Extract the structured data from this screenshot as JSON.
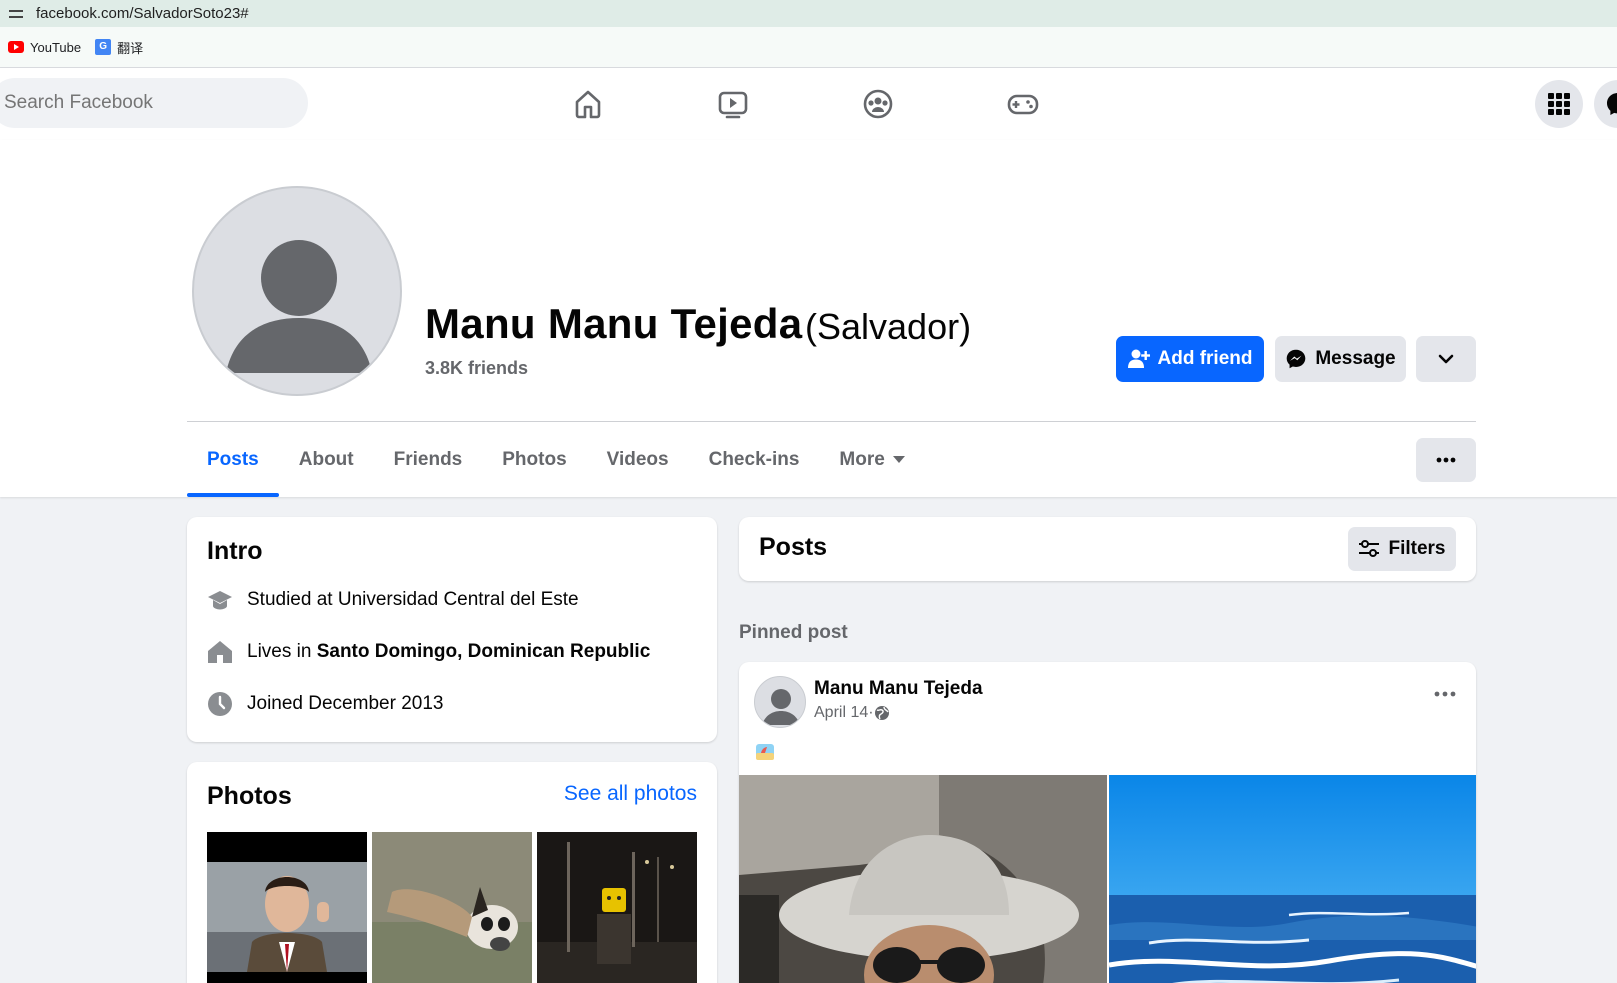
{
  "browser": {
    "url": "facebook.com/SalvadorSoto23#",
    "bookmarks": [
      {
        "label": "YouTube",
        "icon": "youtube-icon"
      },
      {
        "label": "翻译",
        "icon": "translate-icon"
      }
    ]
  },
  "nav": {
    "search_placeholder": "Search Facebook",
    "icons": [
      "home-icon",
      "video-icon",
      "groups-icon",
      "gaming-icon",
      "menu-grid-icon",
      "messenger-icon"
    ]
  },
  "profile": {
    "name": "Manu Manu Tejeda",
    "alternate_name": "(Salvador)",
    "friends": "3.8K friends",
    "add_friend_label": "Add friend",
    "message_label": "Message"
  },
  "tabs": [
    {
      "label": "Posts",
      "active": true
    },
    {
      "label": "About"
    },
    {
      "label": "Friends"
    },
    {
      "label": "Photos"
    },
    {
      "label": "Videos"
    },
    {
      "label": "Check-ins"
    },
    {
      "label": "More"
    }
  ],
  "intro": {
    "title": "Intro",
    "studied": "Studied at Universidad Central del Este",
    "lives_prefix": "Lives in ",
    "lives_place": "Santo Domingo, Dominican Republic",
    "joined": "Joined December 2013"
  },
  "photos": {
    "title": "Photos",
    "see_all": "See all photos"
  },
  "posts": {
    "title": "Posts",
    "filters_label": "Filters",
    "pinned_label": "Pinned post",
    "post": {
      "author": "Manu Manu Tejeda",
      "date": "April 14",
      "separator": " · "
    }
  },
  "colors": {
    "primary": "#0866ff",
    "secondary_text": "#65676b",
    "background": "#f0f2f5"
  }
}
